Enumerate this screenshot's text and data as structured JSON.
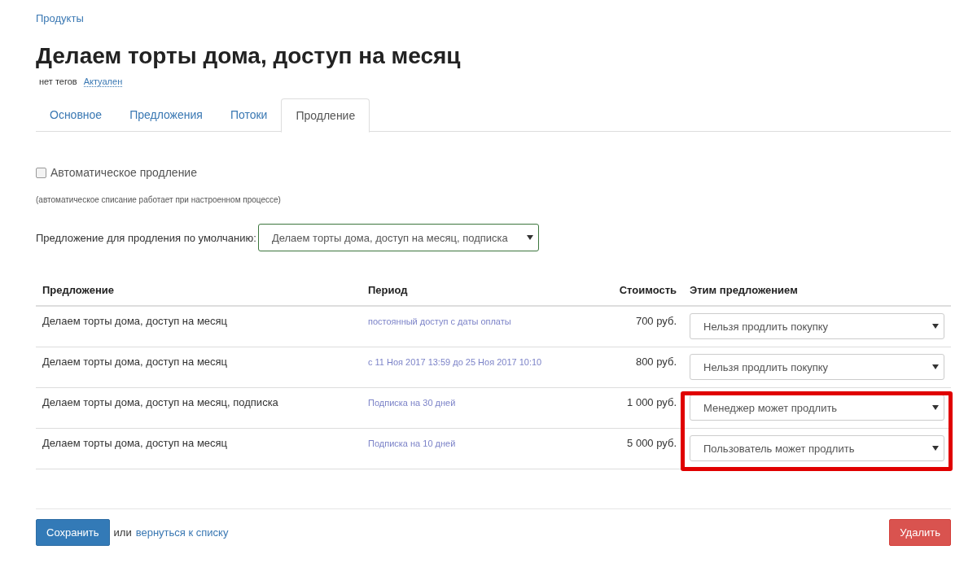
{
  "breadcrumb": "Продукты",
  "title": "Делаем торты дома, доступ на месяц",
  "tags_label": "нет тегов",
  "status_link": "Актуален",
  "tabs": [
    {
      "label": "Основное",
      "selected": false
    },
    {
      "label": "Предложения",
      "selected": false
    },
    {
      "label": "Потоки",
      "selected": false
    },
    {
      "label": "Продление",
      "selected": true
    }
  ],
  "auto_renewal": {
    "label": "Автоматическое продление",
    "checked": false
  },
  "note": "(автоматическое списание работает при настроенном процессе)",
  "default_offer": {
    "label": "Предложение для продления по умолчанию:",
    "value": "Делаем торты дома, доступ на месяц, подписка"
  },
  "table": {
    "columns": [
      "Предложение",
      "Период",
      "Стоимость",
      "Этим предложением"
    ],
    "rows": [
      {
        "offer": "Делаем торты дома, доступ на месяц",
        "period": "постоянный доступ с даты оплаты",
        "price": "700 руб.",
        "action": "Нельзя продлить покупку",
        "highlighted": false
      },
      {
        "offer": "Делаем торты дома, доступ на месяц",
        "period": "с 11 Ноя 2017 13:59 до 25 Ноя 2017 10:10",
        "price": "800 руб.",
        "action": "Нельзя продлить покупку",
        "highlighted": false
      },
      {
        "offer": "Делаем торты дома, доступ на месяц, подписка",
        "period": "Подписка на 30 дней",
        "price": "1 000 руб.",
        "action": "Менеджер может продлить",
        "highlighted": true
      },
      {
        "offer": "Делаем торты дома, доступ на месяц",
        "period": "Подписка на 10 дней",
        "price": "5 000 руб.",
        "action": "Пользователь может продлить",
        "highlighted": true
      }
    ]
  },
  "footer": {
    "save": "Сохранить",
    "or": "или",
    "back_link": "вернуться к списку",
    "delete": "Удалить"
  }
}
